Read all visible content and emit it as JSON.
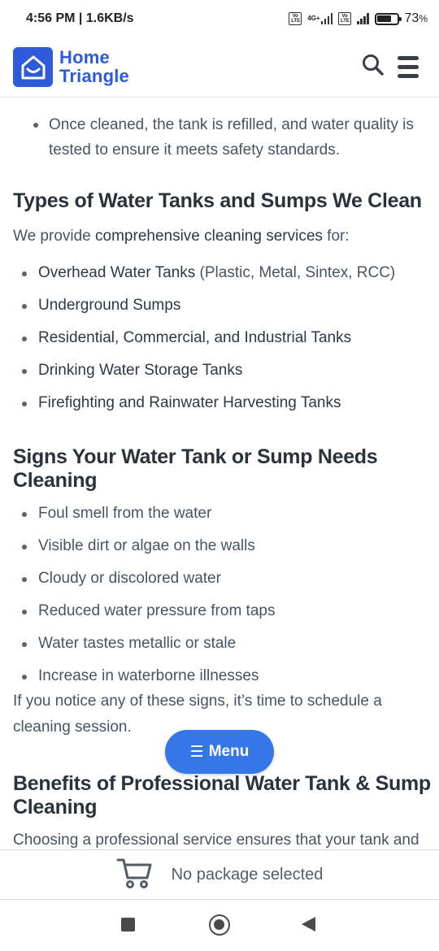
{
  "status_bar": {
    "time": "4:56 PM",
    "speed": "1.6KB/s",
    "sim1_badge": "Vo LTE",
    "network_type": "4G+",
    "sim2_badge": "Vo LTE",
    "battery_percent": "73",
    "battery_suffix": "%",
    "battery_level": 0.73
  },
  "header": {
    "logo_line1": "Home",
    "logo_line2": "Triangle",
    "search_icon": "search-icon",
    "menu_icon": "hamburger-icon"
  },
  "content": {
    "intro_bullet": "Once cleaned, the tank is refilled, and water quality is tested to ensure it meets safety standards.",
    "section_types": {
      "heading": "Types of Water Tanks and Sumps We Clean",
      "intro_plain": "We provide ",
      "intro_strong": "comprehensive cleaning services",
      "intro_end": " for:",
      "items": [
        {
          "strong": "Overhead Water Tanks",
          "plain": " (Plastic, Metal, Sintex, RCC)"
        },
        {
          "strong": "Underground Sumps",
          "plain": ""
        },
        {
          "strong": "Residential, Commercial, and Industrial Tanks",
          "plain": ""
        },
        {
          "strong": "Drinking Water Storage Tanks",
          "plain": ""
        },
        {
          "strong": "Firefighting and Rainwater Harvesting Tanks",
          "plain": ""
        }
      ]
    },
    "section_signs": {
      "heading_line1": "Signs Your Water Tank or Sump Needs",
      "heading_line2": "Cleaning",
      "items": [
        "Foul smell from the water",
        "Visible dirt or algae on the walls",
        "Cloudy or discolored water",
        "Reduced water pressure from taps",
        "Water tastes metallic or stale",
        "Increase in waterborne illnesses"
      ],
      "outro_line1": "If you notice any of these signs, it’s time to schedule a",
      "outro_line2": "cleaning session."
    },
    "section_benefits": {
      "heading_line1": "Benefits of Professional Water Tank & Sump",
      "heading_line2": "Cleaning",
      "intro": "Choosing a professional service ensures that your tank and"
    }
  },
  "menu_button": {
    "icon": "☰",
    "label": "Menu"
  },
  "package_bar": {
    "icon": "cart-icon",
    "label": "No package selected"
  },
  "nav_bar": {
    "recents": "square-icon",
    "home": "home-circle-icon",
    "back": "back-triangle-icon"
  },
  "colors": {
    "brand": "#2e5bd9",
    "menu_button": "#3577e8",
    "heading": "#2a323c",
    "body_text": "#4a5361"
  }
}
